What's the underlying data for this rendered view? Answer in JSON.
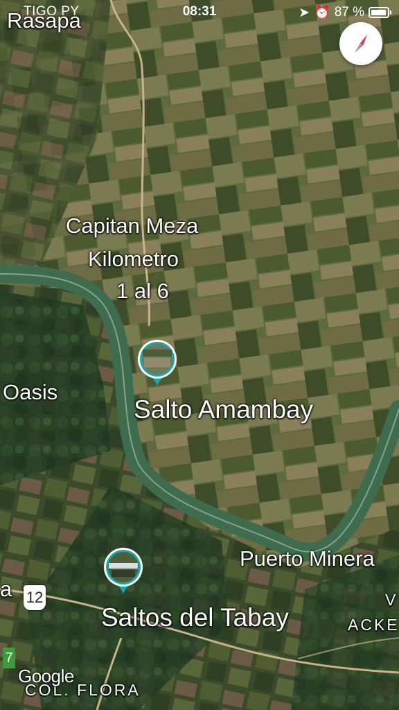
{
  "status_bar": {
    "carrier": "TIGO PY",
    "time": "08:31",
    "battery": "87 %"
  },
  "map": {
    "places": {
      "rasapa": "Rasapa",
      "capitan_meza": [
        "Capitan Meza",
        "Kilometro",
        "1 al 6"
      ],
      "oasis": "Oasis",
      "salto_amambay": "Salto Amambay",
      "puerto_minera": "Puerto Minera",
      "saltos_del_tabay": "Saltos del Tabay",
      "col_flora": "COL. FLORA",
      "acke": "ACKE",
      "v": "V",
      "a": "a"
    },
    "road_shields": {
      "route_12": "12",
      "route_7": "7"
    },
    "attribution": "Google",
    "colors": {
      "river": "#3f6b4f",
      "road": "#c8b48a",
      "accent_compass": "#e53935"
    }
  }
}
